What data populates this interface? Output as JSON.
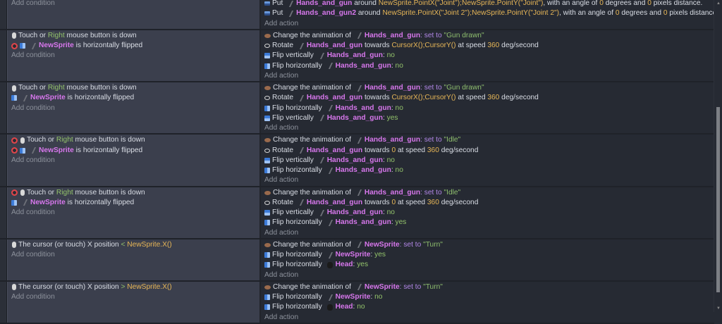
{
  "labels": {
    "add_condition": "Add condition",
    "add_action": "Add action"
  },
  "events": [
    {
      "conditions": [],
      "actions": [
        {
          "icons": [
            "put"
          ],
          "parts": [
            [
              "t",
              "Put "
            ],
            [
              "thumb",
              ""
            ],
            [
              "o",
              "Hands_and_gun"
            ],
            [
              "t",
              " around "
            ],
            [
              "n",
              "NewSprite.PointX(\"Joint\");NewSprite.PointY(\"Joint\")"
            ],
            [
              "t",
              ", with an angle of "
            ],
            [
              "n",
              "0"
            ],
            [
              "t",
              " degrees and "
            ],
            [
              "n",
              "0"
            ],
            [
              "t",
              " pixels distance."
            ]
          ]
        },
        {
          "icons": [
            "put"
          ],
          "parts": [
            [
              "t",
              "Put "
            ],
            [
              "thumb",
              ""
            ],
            [
              "o",
              "Hands_and_gun2"
            ],
            [
              "t",
              " around "
            ],
            [
              "n",
              "NewSprite.PointX(\"Joint 2\");NewSprite.PointY(\"Joint 2\")"
            ],
            [
              "t",
              ", with an angle of "
            ],
            [
              "n",
              "0"
            ],
            [
              "t",
              " degrees and "
            ],
            [
              "n",
              "0"
            ],
            [
              "t",
              " pixels distance."
            ]
          ]
        }
      ]
    },
    {
      "conditions": [
        {
          "icons": [
            "touch"
          ],
          "parts": [
            [
              "t",
              "Touch or "
            ],
            [
              "g",
              "Right"
            ],
            [
              "t",
              " mouse button is down"
            ]
          ]
        },
        {
          "icons": [
            "invert",
            "fliph"
          ],
          "parts": [
            [
              "thumb",
              ""
            ],
            [
              "o",
              "NewSprite"
            ],
            [
              "t",
              " is horizontally flipped"
            ]
          ]
        }
      ],
      "actions": [
        {
          "icons": [
            "anim"
          ],
          "parts": [
            [
              "t",
              "Change the animation of "
            ],
            [
              "thumb",
              ""
            ],
            [
              "o",
              "Hands_and_gun"
            ],
            [
              "k",
              ": set to "
            ],
            [
              "s",
              "\"Gun drawn\""
            ]
          ]
        },
        {
          "icons": [
            "rotate"
          ],
          "parts": [
            [
              "t",
              "Rotate "
            ],
            [
              "thumb",
              ""
            ],
            [
              "o",
              "Hands_and_gun"
            ],
            [
              "t",
              " towards "
            ],
            [
              "n",
              "CursorX();CursorY()"
            ],
            [
              "t",
              " at speed "
            ],
            [
              "n",
              "360"
            ],
            [
              "t",
              " deg/second"
            ]
          ]
        },
        {
          "icons": [
            "flipv"
          ],
          "parts": [
            [
              "t",
              "Flip vertically "
            ],
            [
              "thumb",
              ""
            ],
            [
              "o",
              "Hands_and_gun"
            ],
            [
              "t",
              ": "
            ],
            [
              "g",
              "no"
            ]
          ]
        },
        {
          "icons": [
            "fliph"
          ],
          "parts": [
            [
              "t",
              "Flip horizontally "
            ],
            [
              "thumb",
              ""
            ],
            [
              "o",
              "Hands_and_gun"
            ],
            [
              "t",
              ": "
            ],
            [
              "g",
              "no"
            ]
          ]
        }
      ]
    },
    {
      "conditions": [
        {
          "icons": [
            "touch"
          ],
          "parts": [
            [
              "t",
              "Touch or "
            ],
            [
              "g",
              "Right"
            ],
            [
              "t",
              " mouse button is down"
            ]
          ]
        },
        {
          "icons": [
            "fliph"
          ],
          "parts": [
            [
              "thumb",
              ""
            ],
            [
              "o",
              "NewSprite"
            ],
            [
              "t",
              " is horizontally flipped"
            ]
          ]
        }
      ],
      "actions": [
        {
          "icons": [
            "anim"
          ],
          "parts": [
            [
              "t",
              "Change the animation of "
            ],
            [
              "thumb",
              ""
            ],
            [
              "o",
              "Hands_and_gun"
            ],
            [
              "k",
              ": set to "
            ],
            [
              "s",
              "\"Gun drawn\""
            ]
          ]
        },
        {
          "icons": [
            "rotate"
          ],
          "parts": [
            [
              "t",
              "Rotate "
            ],
            [
              "thumb",
              ""
            ],
            [
              "o",
              "Hands_and_gun"
            ],
            [
              "t",
              " towards "
            ],
            [
              "n",
              "CursorX();CursorY()"
            ],
            [
              "t",
              " at speed "
            ],
            [
              "n",
              "360"
            ],
            [
              "t",
              " deg/second"
            ]
          ]
        },
        {
          "icons": [
            "fliph"
          ],
          "parts": [
            [
              "t",
              "Flip horizontally "
            ],
            [
              "thumb",
              ""
            ],
            [
              "o",
              "Hands_and_gun"
            ],
            [
              "t",
              ": "
            ],
            [
              "g",
              "no"
            ]
          ]
        },
        {
          "icons": [
            "flipv"
          ],
          "parts": [
            [
              "t",
              "Flip vertically "
            ],
            [
              "thumb",
              ""
            ],
            [
              "o",
              "Hands_and_gun"
            ],
            [
              "t",
              ": "
            ],
            [
              "g",
              "yes"
            ]
          ]
        }
      ]
    },
    {
      "conditions": [
        {
          "icons": [
            "invert",
            "touch"
          ],
          "parts": [
            [
              "t",
              "Touch or "
            ],
            [
              "g",
              "Right"
            ],
            [
              "t",
              " mouse button is down"
            ]
          ]
        },
        {
          "icons": [
            "invert",
            "fliph"
          ],
          "parts": [
            [
              "thumb",
              ""
            ],
            [
              "o",
              "NewSprite"
            ],
            [
              "t",
              " is horizontally flipped"
            ]
          ]
        }
      ],
      "actions": [
        {
          "icons": [
            "anim"
          ],
          "parts": [
            [
              "t",
              "Change the animation of "
            ],
            [
              "thumb",
              ""
            ],
            [
              "o",
              "Hands_and_gun"
            ],
            [
              "k",
              ": set to "
            ],
            [
              "s",
              "\"Idle\""
            ]
          ]
        },
        {
          "icons": [
            "rotate"
          ],
          "parts": [
            [
              "t",
              "Rotate "
            ],
            [
              "thumb",
              ""
            ],
            [
              "o",
              "Hands_and_gun"
            ],
            [
              "t",
              " towards "
            ],
            [
              "n",
              "0"
            ],
            [
              "t",
              " at speed "
            ],
            [
              "n",
              "360"
            ],
            [
              "t",
              " deg/second"
            ]
          ]
        },
        {
          "icons": [
            "flipv"
          ],
          "parts": [
            [
              "t",
              "Flip vertically "
            ],
            [
              "thumb",
              ""
            ],
            [
              "o",
              "Hands_and_gun"
            ],
            [
              "t",
              ": "
            ],
            [
              "g",
              "no"
            ]
          ]
        },
        {
          "icons": [
            "fliph"
          ],
          "parts": [
            [
              "t",
              "Flip horizontally "
            ],
            [
              "thumb",
              ""
            ],
            [
              "o",
              "Hands_and_gun"
            ],
            [
              "t",
              ": "
            ],
            [
              "g",
              "no"
            ]
          ]
        }
      ]
    },
    {
      "conditions": [
        {
          "icons": [
            "invert",
            "touch"
          ],
          "parts": [
            [
              "t",
              "Touch or "
            ],
            [
              "g",
              "Right"
            ],
            [
              "t",
              " mouse button is down"
            ]
          ]
        },
        {
          "icons": [
            "fliph"
          ],
          "parts": [
            [
              "thumb",
              ""
            ],
            [
              "o",
              "NewSprite"
            ],
            [
              "t",
              " is horizontally flipped"
            ]
          ]
        }
      ],
      "actions": [
        {
          "icons": [
            "anim"
          ],
          "parts": [
            [
              "t",
              "Change the animation of "
            ],
            [
              "thumb",
              ""
            ],
            [
              "o",
              "Hands_and_gun"
            ],
            [
              "k",
              ": set to "
            ],
            [
              "s",
              "\"Idle\""
            ]
          ]
        },
        {
          "icons": [
            "rotate"
          ],
          "parts": [
            [
              "t",
              "Rotate "
            ],
            [
              "thumb",
              ""
            ],
            [
              "o",
              "Hands_and_gun"
            ],
            [
              "t",
              " towards "
            ],
            [
              "n",
              "0"
            ],
            [
              "t",
              " at speed "
            ],
            [
              "n",
              "360"
            ],
            [
              "t",
              " deg/second"
            ]
          ]
        },
        {
          "icons": [
            "flipv"
          ],
          "parts": [
            [
              "t",
              "Flip vertically "
            ],
            [
              "thumb",
              ""
            ],
            [
              "o",
              "Hands_and_gun"
            ],
            [
              "t",
              ": "
            ],
            [
              "g",
              "no"
            ]
          ]
        },
        {
          "icons": [
            "fliph"
          ],
          "parts": [
            [
              "t",
              "Flip horizontally "
            ],
            [
              "thumb",
              ""
            ],
            [
              "o",
              "Hands_and_gun"
            ],
            [
              "t",
              ": "
            ],
            [
              "g",
              "yes"
            ]
          ]
        }
      ]
    },
    {
      "conditions": [
        {
          "icons": [
            "touch"
          ],
          "parts": [
            [
              "t",
              "The cursor (or touch) X position "
            ],
            [
              "g",
              "< "
            ],
            [
              "n",
              "NewSprite.X()"
            ]
          ]
        }
      ],
      "actions": [
        {
          "icons": [
            "anim"
          ],
          "parts": [
            [
              "t",
              "Change the animation of "
            ],
            [
              "thumb",
              ""
            ],
            [
              "o",
              "NewSprite"
            ],
            [
              "k",
              ": set to "
            ],
            [
              "s",
              "\"Turn\""
            ]
          ]
        },
        {
          "icons": [
            "fliph"
          ],
          "parts": [
            [
              "t",
              "Flip horizontally "
            ],
            [
              "thumb",
              ""
            ],
            [
              "o",
              "NewSprite"
            ],
            [
              "t",
              ": "
            ],
            [
              "g",
              "yes"
            ]
          ]
        },
        {
          "icons": [
            "fliph"
          ],
          "parts": [
            [
              "t",
              "Flip horizontally "
            ],
            [
              "thumbdark",
              ""
            ],
            [
              "o",
              "Head"
            ],
            [
              "t",
              ": "
            ],
            [
              "g",
              "yes"
            ]
          ]
        }
      ]
    },
    {
      "conditions": [
        {
          "icons": [
            "touch"
          ],
          "parts": [
            [
              "t",
              "The cursor (or touch) X position "
            ],
            [
              "g",
              "> "
            ],
            [
              "n",
              "NewSprite.X()"
            ]
          ]
        }
      ],
      "actions": [
        {
          "icons": [
            "anim"
          ],
          "parts": [
            [
              "t",
              "Change the animation of "
            ],
            [
              "thumb",
              ""
            ],
            [
              "o",
              "NewSprite"
            ],
            [
              "k",
              ": set to "
            ],
            [
              "s",
              "\"Turn\""
            ]
          ]
        },
        {
          "icons": [
            "fliph"
          ],
          "parts": [
            [
              "t",
              "Flip horizontally "
            ],
            [
              "thumb",
              ""
            ],
            [
              "o",
              "NewSprite"
            ],
            [
              "t",
              ": "
            ],
            [
              "g",
              "no"
            ]
          ]
        },
        {
          "icons": [
            "fliph"
          ],
          "parts": [
            [
              "t",
              "Flip horizontally "
            ],
            [
              "thumbdark",
              ""
            ],
            [
              "o",
              "Head"
            ],
            [
              "t",
              ": "
            ],
            [
              "g",
              "no"
            ]
          ]
        }
      ]
    }
  ]
}
